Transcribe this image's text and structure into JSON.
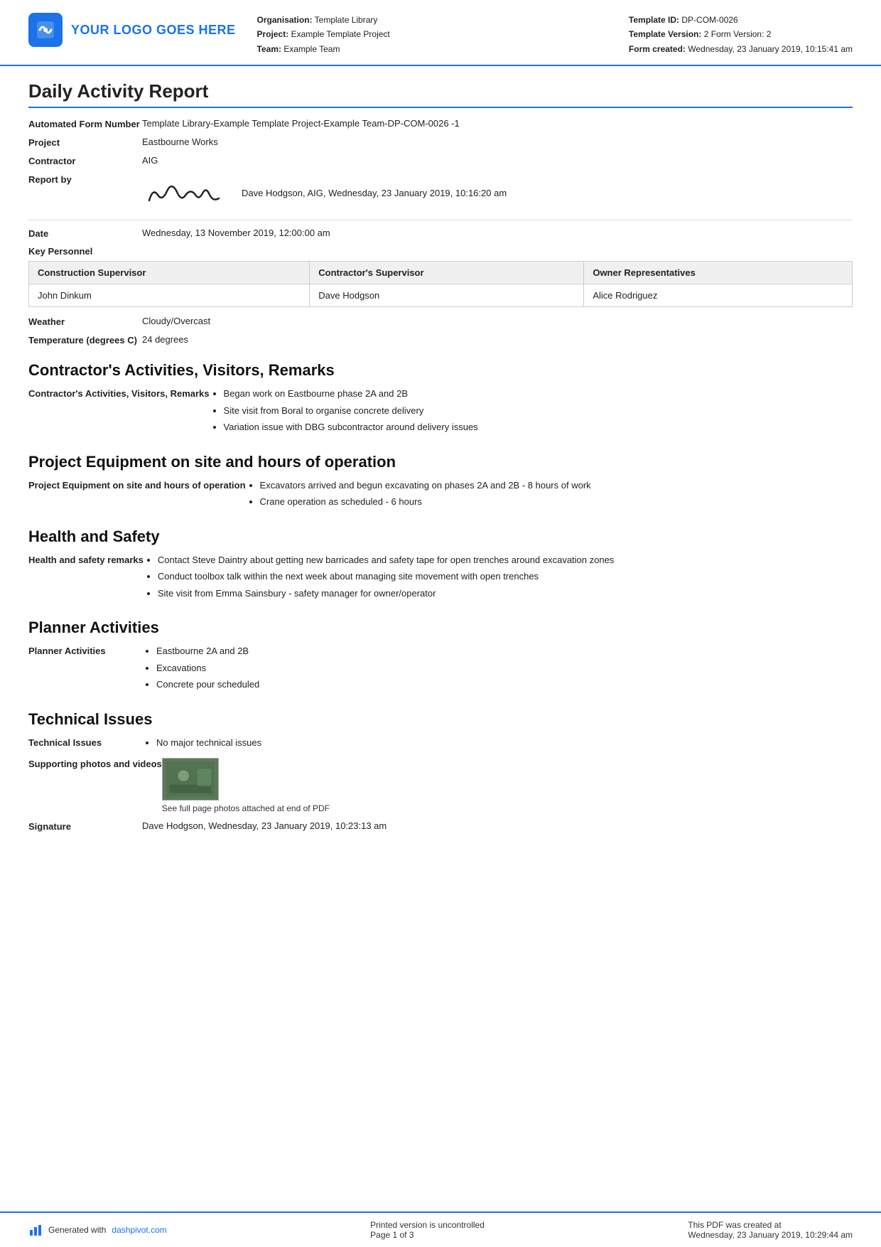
{
  "header": {
    "logo_text": "YOUR LOGO GOES HERE",
    "org_label": "Organisation:",
    "org_value": "Template Library",
    "project_label": "Project:",
    "project_value": "Example Template Project",
    "team_label": "Team:",
    "team_value": "Example Team",
    "template_id_label": "Template ID:",
    "template_id_value": "DP-COM-0026",
    "template_version_label": "Template Version:",
    "template_version_value": "2 Form Version: 2",
    "form_created_label": "Form created:",
    "form_created_value": "Wednesday, 23 January 2019, 10:15:41 am"
  },
  "report": {
    "title": "Daily Activity Report",
    "automated_form_number_label": "Automated Form Number",
    "automated_form_number_value": "Template Library-Example Template Project-Example Team-DP-COM-0026   -1",
    "project_label": "Project",
    "project_value": "Eastbourne Works",
    "contractor_label": "Contractor",
    "contractor_value": "AIG",
    "report_by_label": "Report by",
    "report_by_value": "Dave Hodgson, AIG, Wednesday, 23 January 2019, 10:16:20 am",
    "date_label": "Date",
    "date_value": "Wednesday, 13 November 2019, 12:00:00 am",
    "key_personnel_label": "Key Personnel",
    "personnel_col1": "Construction Supervisor",
    "personnel_col2": "Contractor's Supervisor",
    "personnel_col3": "Owner Representatives",
    "personnel_row1_col1": "John Dinkum",
    "personnel_row1_col2": "Dave Hodgson",
    "personnel_row1_col3": "Alice Rodriguez",
    "weather_label": "Weather",
    "weather_value": "Cloudy/Overcast",
    "temperature_label": "Temperature (degrees C)",
    "temperature_value": "24 degrees"
  },
  "sections": {
    "activities_title": "Contractor's Activities, Visitors, Remarks",
    "activities_label": "Contractor's Activities, Visitors, Remarks",
    "activities_items": [
      "Began work on Eastbourne phase 2A and 2B",
      "Site visit from Boral to organise concrete delivery",
      "Variation issue with DBG subcontractor around delivery issues"
    ],
    "equipment_title": "Project Equipment on site and hours of operation",
    "equipment_label": "Project Equipment on site and hours of operation",
    "equipment_items": [
      "Excavators arrived and begun excavating on phases 2A and 2B - 8 hours of work",
      "Crane operation as scheduled - 6 hours"
    ],
    "health_title": "Health and Safety",
    "health_label": "Health and safety remarks",
    "health_items": [
      "Contact Steve Daintry about getting new barricades and safety tape for open trenches around excavation zones",
      "Conduct toolbox talk within the next week about managing site movement with open trenches",
      "Site visit from Emma Sainsbury - safety manager for owner/operator"
    ],
    "planner_title": "Planner Activities",
    "planner_label": "Planner Activities",
    "planner_items": [
      "Eastbourne 2A and 2B",
      "Excavations",
      "Concrete pour scheduled"
    ],
    "technical_title": "Technical Issues",
    "technical_label": "Technical Issues",
    "technical_items": [
      "No major technical issues"
    ],
    "supporting_label": "Supporting photos and videos",
    "supporting_caption": "See full page photos attached at end of PDF",
    "signature_label": "Signature",
    "signature_value": "Dave Hodgson, Wednesday, 23 January 2019, 10:23:13 am"
  },
  "footer": {
    "generated_text": "Generated with ",
    "dashpivot_link": "dashpivot.com",
    "uncontrolled_text": "Printed version is uncontrolled",
    "page_text": "Page 1 of 3",
    "pdf_created_text": "This PDF was created at",
    "pdf_created_date": "Wednesday, 23 January 2019, 10:29:44 am"
  }
}
